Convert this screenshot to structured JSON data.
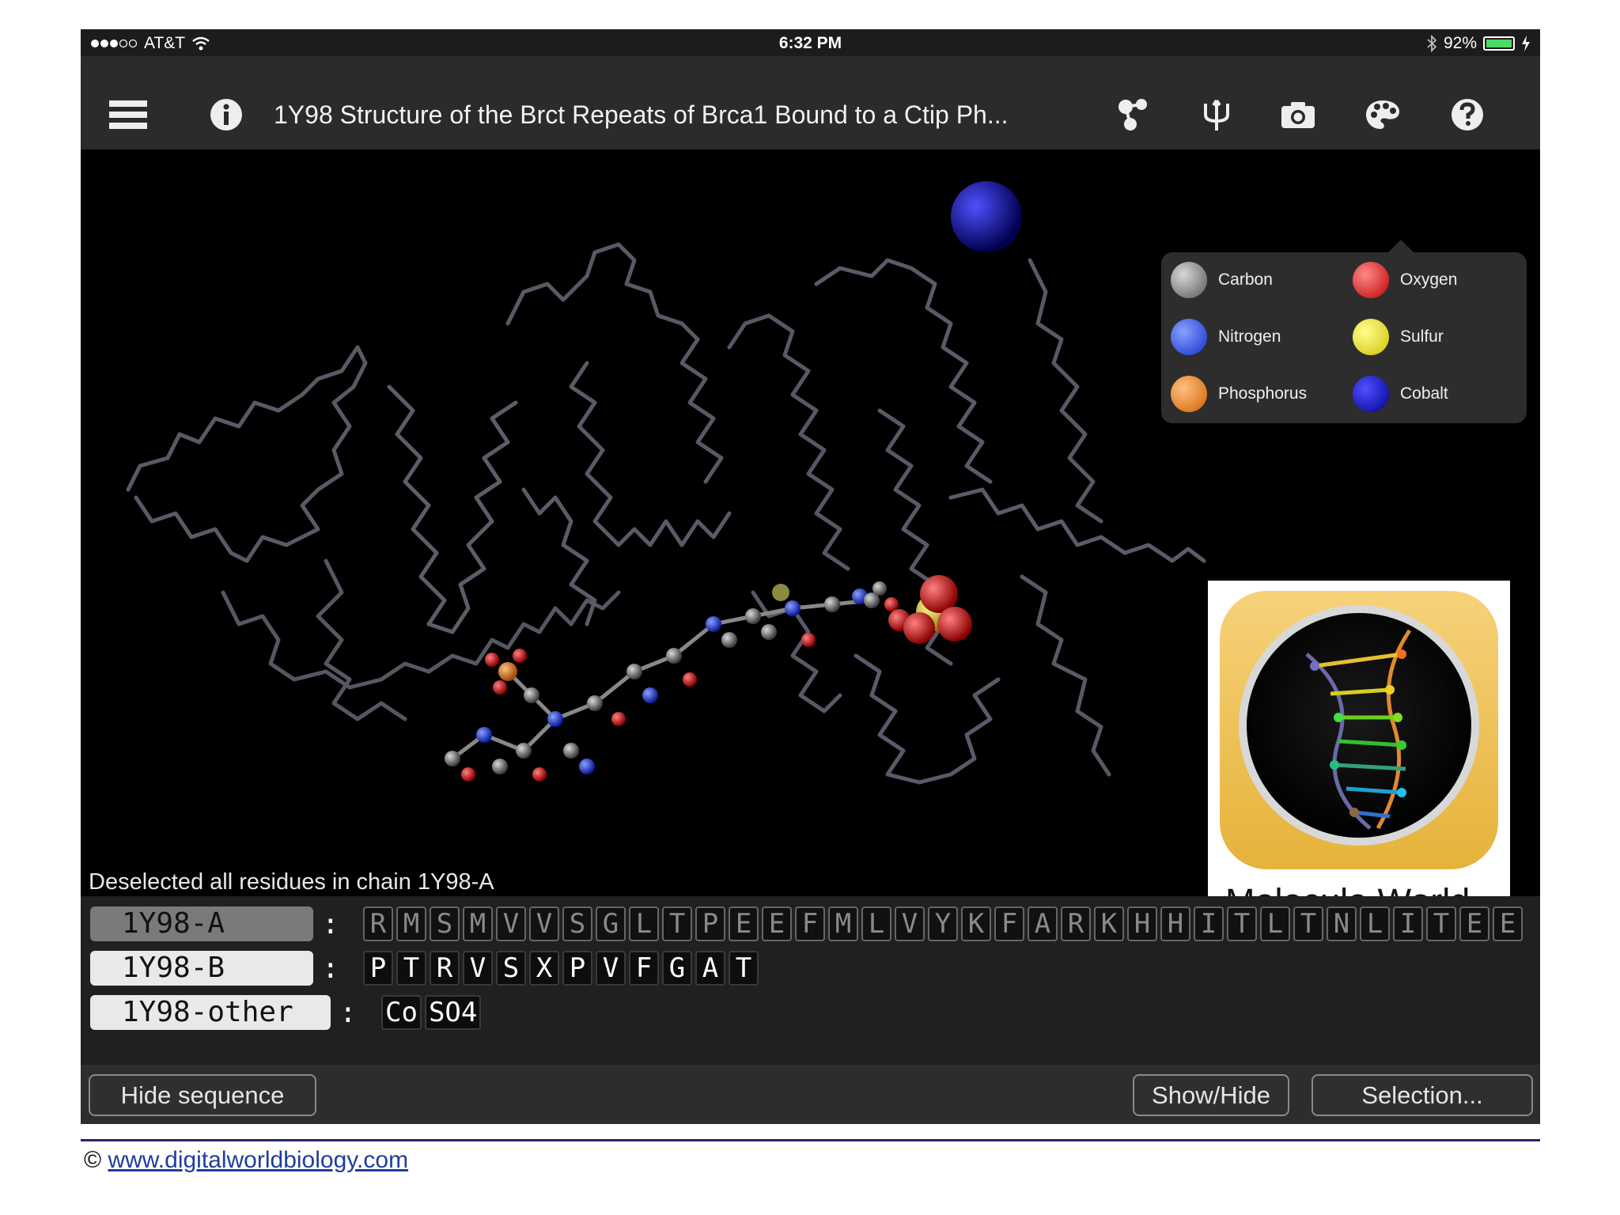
{
  "status_bar": {
    "carrier": "AT&T",
    "time": "6:32 PM",
    "battery": "92%",
    "battery_level": 0.92
  },
  "toolbar": {
    "title": "1Y98 Structure of the Brct Repeats of Brca1 Bound to a Ctip Ph...",
    "icons": [
      "menu-icon",
      "info-icon",
      "molecule-icon",
      "trident-icon",
      "camera-icon",
      "palette-icon",
      "help-icon"
    ]
  },
  "legend": {
    "items": [
      {
        "label": "Carbon",
        "color": "#8c8c8c"
      },
      {
        "label": "Oxygen",
        "color": "#e01818"
      },
      {
        "label": "Nitrogen",
        "color": "#2244ee"
      },
      {
        "label": "Sulfur",
        "color": "#f4e81c"
      },
      {
        "label": "Phosphorus",
        "color": "#f08010"
      },
      {
        "label": "Cobalt",
        "color": "#1010b8"
      }
    ]
  },
  "logo": {
    "caption": "Molecule World"
  },
  "status_message": "Deselected all residues in chain 1Y98-A",
  "sequence": {
    "chains": [
      {
        "name": "1Y98-A",
        "residues": [
          "R",
          "M",
          "S",
          "M",
          "V",
          "V",
          "S",
          "G",
          "L",
          "T",
          "P",
          "E",
          "E",
          "F",
          "M",
          "L",
          "V",
          "Y",
          "K",
          "F",
          "A",
          "R",
          "K",
          "H",
          "H",
          "I",
          "T",
          "L",
          "T",
          "N",
          "L",
          "I",
          "T",
          "E",
          "E"
        ]
      },
      {
        "name": "1Y98-B",
        "residues": [
          "P",
          "T",
          "R",
          "V",
          "S",
          "X",
          "P",
          "V",
          "F",
          "G",
          "A",
          "T"
        ]
      },
      {
        "name": "1Y98-other",
        "residues": [
          "Co",
          "SO4"
        ]
      }
    ]
  },
  "buttons": {
    "hide_sequence": "Hide sequence",
    "show_hide": "Show/Hide",
    "selection": "Selection..."
  },
  "footer": {
    "copyright": "©",
    "link": "www.digitalworldbiology.com"
  }
}
